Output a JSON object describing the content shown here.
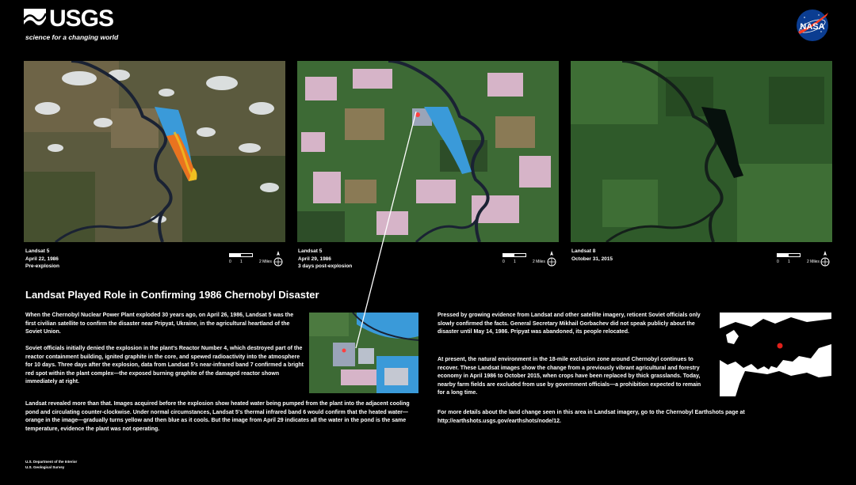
{
  "header": {
    "agency_name": "USGS",
    "agency_tagline": "science for a changing world",
    "partner_name": "NASA"
  },
  "panels": [
    {
      "satellite": "Landsat 5",
      "date": "April 22, 1986",
      "note": "Pre-explosion"
    },
    {
      "satellite": "Landsat 5",
      "date": "April 29, 1986",
      "note": "3 days post-explosion"
    },
    {
      "satellite": "Landsat 8",
      "date": "October 31, 2015",
      "note": ""
    }
  ],
  "scale_bar": {
    "tick_0": "0",
    "tick_1": "1",
    "unit": "2 Miles"
  },
  "article": {
    "headline": "Landsat Played Role in Confirming 1986 Chernobyl Disaster",
    "paragraphs_left": [
      "When the Chernobyl Nuclear Power Plant exploded 30 years ago, on April 26, 1986, Landsat 5 was the first civilian satellite to confirm the disaster near Pripyat, Ukraine, in the agricultural heartland of the Soviet Union.",
      "Soviet officials initially denied the explosion in the plant’s Reactor Number 4, which destroyed part of the reactor containment building, ignited graphite in the core, and spewed radioactivity into the atmosphere for 10 days. Three days after the explosion, data from Landsat 5’s near-infrared band 7 confirmed a bright red spot within the plant complex—the exposed burning graphite of the damaged reactor shown immediately at right.",
      "Landsat revealed more than that. Images acquired before the explosion show heated water being pumped from the plant into the adjacent cooling pond and circulating counter-clockwise. Under normal circumstances, Landsat 5’s thermal infrared band 6 would confirm that the heated water—orange in the image—gradually turns yellow and then blue as it cools. But the image from April 29 indicates all the water in the pond is the same temperature, evidence the plant was not operating."
    ],
    "paragraphs_right": [
      "Pressed by growing evidence from Landsat and other satellite imagery, reticent Soviet officials only slowly confirmed the facts. General Secretary Mikhail Gorbachev did not speak publicly about the disaster until May 14, 1986. Pripyat was abandoned, its people relocated.",
      "At present, the natural environment in the 18-mile exclusion zone around Chernobyl continues to recover. These Landsat images show the change from a previously vibrant agricultural and forestry economy in April 1986 to October 2015, when crops have been replaced by thick grasslands. Today, nearby farm fields are excluded from use by government officials—a prohibition expected to remain for a long time.",
      "For more details about the land change seen in this area in Landsat imagery, go to the Chernobyl Earthshots page at http://earthshots.usgs.gov/earthshots/node/12."
    ]
  },
  "footer": {
    "line1": "U.S. Department of the Interior",
    "line2": "U.S. Geological Survey"
  },
  "colors": {
    "background": "#000000",
    "forest": "#2f5a2a",
    "field": "#7a6a4a",
    "cooling_pond_warm": "#e9731f",
    "cooling_pond_mid": "#f0c020",
    "cooling_pond_cool": "#3a9ad9",
    "river": "#1a2233",
    "nasa_blue": "#0b3d91",
    "nasa_red": "#fc3d21",
    "location_marker": "#e0201a"
  }
}
